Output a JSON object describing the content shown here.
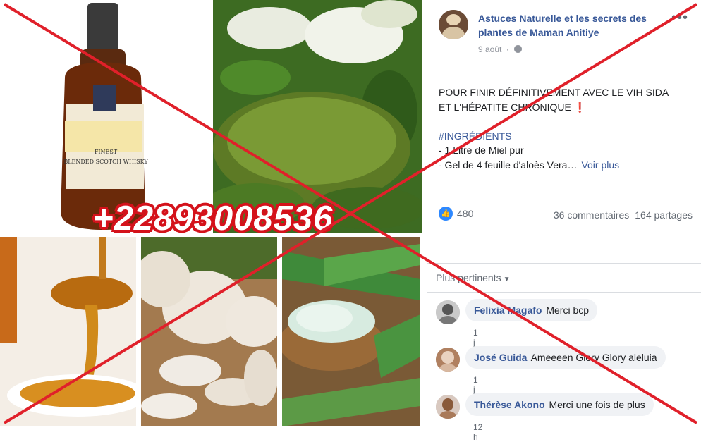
{
  "photos": {
    "bottle_label_1": "FINEST",
    "bottle_label_2": "BLENDED SCOTCH WHISKY",
    "phone_overlay": "+22893008536"
  },
  "post": {
    "page_name": "Astuces Naturelle et les secrets des plantes de Maman Anitiye",
    "date": "9 août",
    "more_label": "•••",
    "text_line1": "POUR FINIR DÉFINITIVEMENT AVEC LE VIH SIDA",
    "text_line2": "ET L'HÉPATITE CHRONIQUE ❗",
    "hashtag": "#INGRÉDIENTS",
    "ingredient1": "- 1 Litre de Miel pur",
    "ingredient2": "- Gel de 4 feuille d'aloès Vera…",
    "see_more": "Voir plus",
    "likes": "480",
    "comments_count": "36 commentaires",
    "shares_count": "164 partages"
  },
  "comments_bar": {
    "sort_label": "Plus pertinents"
  },
  "comments": [
    {
      "author": "Felixia Magafo",
      "text": "Merci bcp",
      "time": "1 j"
    },
    {
      "author": "José Guida",
      "text": "Ameeeen Glory Glory aleluia",
      "time": "1 j"
    },
    {
      "author": "Thérèse Akono",
      "text": "Merci une fois de plus",
      "time": "12 h"
    }
  ],
  "colors": {
    "link": "#385898",
    "cross": "#e0202a",
    "like_blue": "#2d88ff"
  }
}
